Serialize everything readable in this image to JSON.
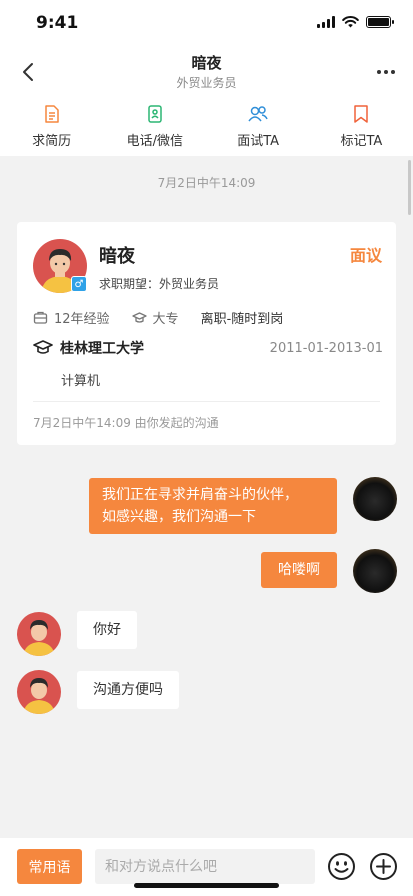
{
  "status_bar": {
    "time": "9:41",
    "battery_level": 1.0
  },
  "header": {
    "title": "暗夜",
    "subtitle": "外贸业务员"
  },
  "actions": [
    {
      "label": "求简历",
      "icon": "resume-icon"
    },
    {
      "label": "电话/微信",
      "icon": "phone-wechat-icon"
    },
    {
      "label": "面试TA",
      "icon": "interview-icon"
    },
    {
      "label": "标记TA",
      "icon": "bookmark-icon"
    }
  ],
  "timestamp": "7月2日中午14:09",
  "candidate": {
    "name": "暗夜",
    "salary": "面议",
    "expectation": "求职期望：外贸业务员",
    "gender_icon": "♂",
    "experience": "12年经验",
    "education": "大专",
    "availability": "离职-随时到岗",
    "school": "桂林理工大学",
    "school_dates": "2011-01-2013-01",
    "major": "计算机",
    "footer": "7月2日中午14:09 由你发起的沟通"
  },
  "messages": [
    {
      "side": "right",
      "line1": "我们正在寻求并肩奋斗的伙伴，",
      "line2": "如感兴趣，我们沟通一下"
    },
    {
      "side": "right",
      "text": "哈喽啊"
    },
    {
      "side": "left",
      "text": "你好"
    },
    {
      "side": "left",
      "text": "沟通方便吗"
    }
  ],
  "input_bar": {
    "quick_reply_label": "常用语",
    "placeholder": "和对方说点什么吧"
  },
  "colors": {
    "accent": "#f5873e",
    "interview_blue": "#2f8ed8",
    "wechat_green": "#2bb673",
    "background": "#f2f2f2"
  }
}
